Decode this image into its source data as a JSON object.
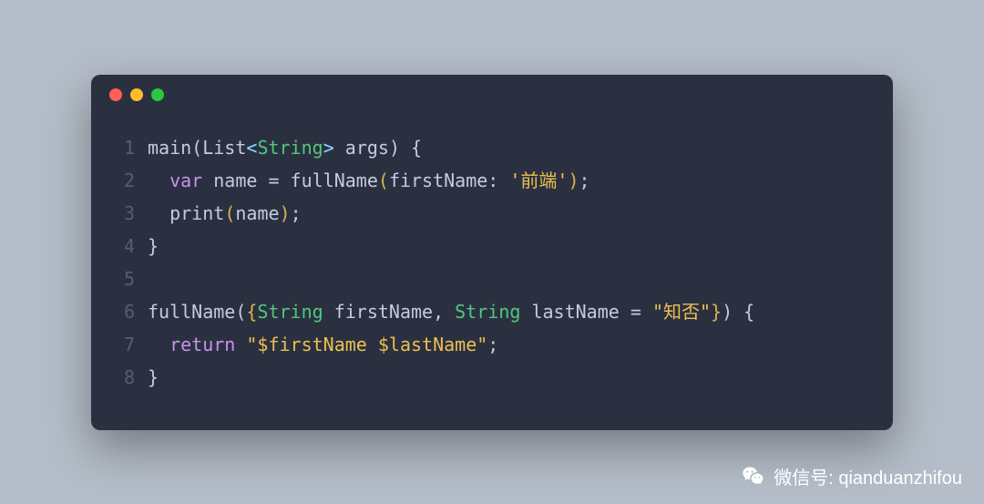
{
  "window": {
    "traffic": {
      "close": "close",
      "minimize": "minimize",
      "maximize": "maximize"
    }
  },
  "code": {
    "lines": [
      {
        "num": "1",
        "tokens": [
          {
            "c": "ident",
            "t": "main"
          },
          {
            "c": "punct",
            "t": "("
          },
          {
            "c": "ident",
            "t": "List"
          },
          {
            "c": "angle",
            "t": "<"
          },
          {
            "c": "type",
            "t": "String"
          },
          {
            "c": "angle",
            "t": ">"
          },
          {
            "c": "ident",
            "t": " args"
          },
          {
            "c": "punct",
            "t": ") {"
          }
        ]
      },
      {
        "num": "2",
        "tokens": [
          {
            "c": "plain",
            "t": "  "
          },
          {
            "c": "keyword",
            "t": "var"
          },
          {
            "c": "ident",
            "t": " name "
          },
          {
            "c": "punct",
            "t": "="
          },
          {
            "c": "ident",
            "t": " fullName"
          },
          {
            "c": "paren",
            "t": "("
          },
          {
            "c": "ident",
            "t": "firstName: "
          },
          {
            "c": "string",
            "t": "'前端'"
          },
          {
            "c": "paren",
            "t": ")"
          },
          {
            "c": "punct",
            "t": ";"
          }
        ]
      },
      {
        "num": "3",
        "tokens": [
          {
            "c": "plain",
            "t": "  "
          },
          {
            "c": "ident",
            "t": "print"
          },
          {
            "c": "paren",
            "t": "("
          },
          {
            "c": "ident",
            "t": "name"
          },
          {
            "c": "paren",
            "t": ")"
          },
          {
            "c": "punct",
            "t": ";"
          }
        ]
      },
      {
        "num": "4",
        "tokens": [
          {
            "c": "punct",
            "t": "}"
          }
        ]
      },
      {
        "num": "5",
        "tokens": []
      },
      {
        "num": "6",
        "tokens": [
          {
            "c": "ident",
            "t": "fullName"
          },
          {
            "c": "punct",
            "t": "("
          },
          {
            "c": "paren",
            "t": "{"
          },
          {
            "c": "type",
            "t": "String"
          },
          {
            "c": "ident",
            "t": " firstName, "
          },
          {
            "c": "type",
            "t": "String"
          },
          {
            "c": "ident",
            "t": " lastName "
          },
          {
            "c": "punct",
            "t": "="
          },
          {
            "c": "ident",
            "t": " "
          },
          {
            "c": "string",
            "t": "\"知否\""
          },
          {
            "c": "paren",
            "t": "}"
          },
          {
            "c": "punct",
            "t": ") {"
          }
        ]
      },
      {
        "num": "7",
        "tokens": [
          {
            "c": "plain",
            "t": "  "
          },
          {
            "c": "keyword",
            "t": "return"
          },
          {
            "c": "ident",
            "t": " "
          },
          {
            "c": "string",
            "t": "\"$firstName $lastName\""
          },
          {
            "c": "punct",
            "t": ";"
          }
        ]
      },
      {
        "num": "8",
        "tokens": [
          {
            "c": "punct",
            "t": "}"
          }
        ]
      }
    ]
  },
  "watermark": {
    "label": "微信号: qianduanzhifou",
    "icon": "wechat-icon"
  }
}
